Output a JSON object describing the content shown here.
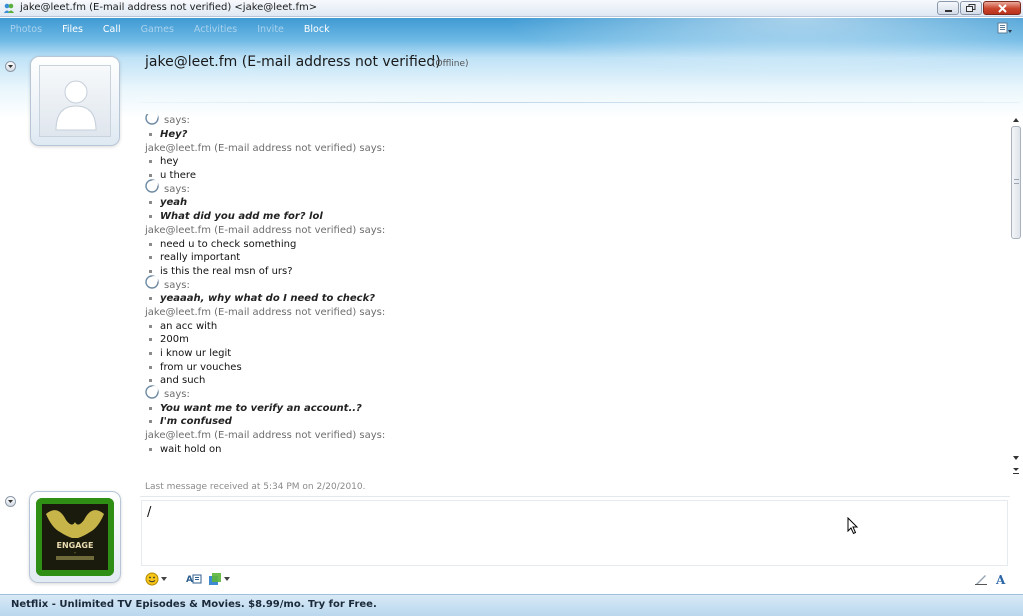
{
  "window": {
    "title": "jake@leet.fm (E-mail address not verified) <jake@leet.fm>"
  },
  "toolbar": {
    "items": [
      {
        "label": "Photos",
        "enabled": false
      },
      {
        "label": "Files",
        "enabled": true
      },
      {
        "label": "Call",
        "enabled": true
      },
      {
        "label": "Games",
        "enabled": false
      },
      {
        "label": "Activities",
        "enabled": false
      },
      {
        "label": "Invite",
        "enabled": false
      },
      {
        "label": "Block",
        "enabled": true
      }
    ]
  },
  "contact": {
    "name": "jake@leet.fm (E-mail address not verified)",
    "status": "(Offline)"
  },
  "conversation": {
    "lines": [
      {
        "kind": "sender",
        "self": true,
        "text": "says:"
      },
      {
        "kind": "msg",
        "mine": true,
        "text": "Hey?"
      },
      {
        "kind": "sender",
        "self": false,
        "text": "jake@leet.fm (E-mail address not verified) says:"
      },
      {
        "kind": "msg",
        "mine": false,
        "text": "hey"
      },
      {
        "kind": "msg",
        "mine": false,
        "text": "u there"
      },
      {
        "kind": "sender",
        "self": true,
        "text": "says:"
      },
      {
        "kind": "msg",
        "mine": true,
        "text": "yeah"
      },
      {
        "kind": "msg",
        "mine": true,
        "text": "What did you add me for? lol"
      },
      {
        "kind": "sender",
        "self": false,
        "text": "jake@leet.fm (E-mail address not verified) says:"
      },
      {
        "kind": "msg",
        "mine": false,
        "text": "need u to check something"
      },
      {
        "kind": "msg",
        "mine": false,
        "text": "really important"
      },
      {
        "kind": "msg",
        "mine": false,
        "text": "is this the real msn of urs?"
      },
      {
        "kind": "sender",
        "self": true,
        "text": "says:"
      },
      {
        "kind": "msg",
        "mine": true,
        "text": "yeaaah, why what do I need to check?"
      },
      {
        "kind": "sender",
        "self": false,
        "text": "jake@leet.fm (E-mail address not verified) says:"
      },
      {
        "kind": "msg",
        "mine": false,
        "text": "an acc with"
      },
      {
        "kind": "msg",
        "mine": false,
        "text": "200m"
      },
      {
        "kind": "msg",
        "mine": false,
        "text": "i know ur legit"
      },
      {
        "kind": "msg",
        "mine": false,
        "text": "from ur vouches"
      },
      {
        "kind": "msg",
        "mine": false,
        "text": "and such"
      },
      {
        "kind": "sender",
        "self": true,
        "text": "says:"
      },
      {
        "kind": "msg",
        "mine": true,
        "text": "You want me to verify an account..?"
      },
      {
        "kind": "msg",
        "mine": true,
        "text": "I'm confused"
      },
      {
        "kind": "sender",
        "self": false,
        "text": "jake@leet.fm (E-mail address not verified) says:"
      },
      {
        "kind": "msg",
        "mine": false,
        "text": "wait hold on"
      }
    ]
  },
  "last_message": "Last message received at 5:34 PM on 2/20/2010.",
  "input": {
    "value": "/"
  },
  "ad": {
    "text": "Netflix - Unlimited TV Episodes & Movies. $8.99/mo. Try for Free."
  },
  "colors": {
    "header_top": "#3f9ad3",
    "window_close": "#c9452c",
    "ad_bar": "#c9e0f2"
  },
  "icons": {
    "app": "msn-messenger-icon",
    "self_sender": "msn-buddy-icon",
    "emoticon": "smiley-icon",
    "translate": "translate-icon",
    "wink": "wink-icon",
    "handwriting": "pen-icon",
    "font": "font-icon",
    "toolbar_menu": "show-menu-icon"
  }
}
